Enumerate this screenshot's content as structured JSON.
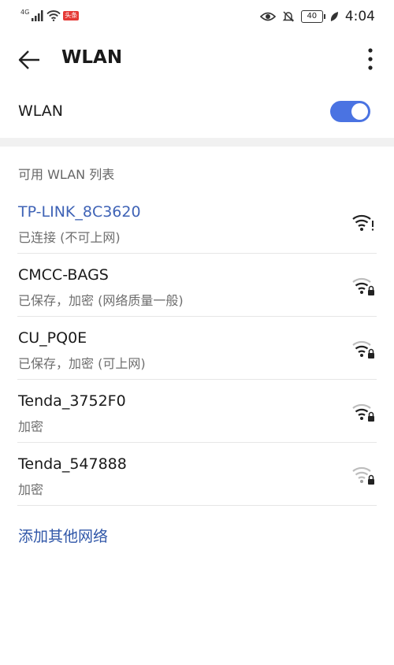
{
  "status_bar": {
    "network_type": "4G",
    "app_badge": "头条",
    "battery": "40",
    "time": "4:04"
  },
  "app_bar": {
    "title": "WLAN"
  },
  "wlan_toggle": {
    "label": "WLAN",
    "enabled": true,
    "accent_color": "#4a73e2"
  },
  "section": {
    "title": "可用 WLAN 列表"
  },
  "networks": [
    {
      "name": "TP-LINK_8C3620",
      "status": "已连接 (不可上网)",
      "connected": true,
      "locked": false,
      "signal": "full-warning"
    },
    {
      "name": "CMCC-BAGS",
      "status": "已保存，加密 (网络质量一般)",
      "connected": false,
      "locked": true,
      "signal": "medium"
    },
    {
      "name": "CU_PQ0E",
      "status": "已保存，加密 (可上网)",
      "connected": false,
      "locked": true,
      "signal": "medium"
    },
    {
      "name": "Tenda_3752F0",
      "status": "加密",
      "connected": false,
      "locked": true,
      "signal": "medium"
    },
    {
      "name": "Tenda_547888",
      "status": "加密",
      "connected": false,
      "locked": true,
      "signal": "weak"
    }
  ],
  "add_network": {
    "label": "添加其他网络"
  }
}
